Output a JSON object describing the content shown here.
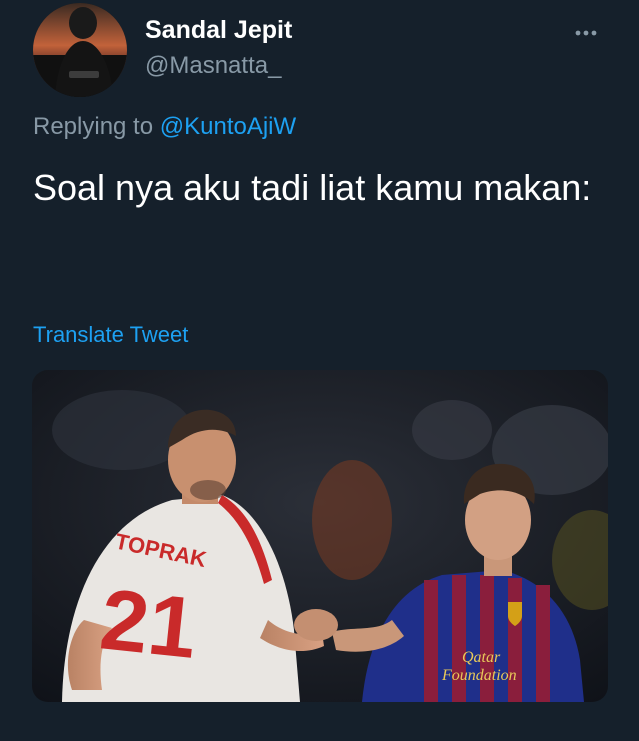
{
  "tweet": {
    "display_name": "Sandal Jepit",
    "handle": "@Masnatta_",
    "reply_prefix": "Replying to",
    "reply_to": "@KuntoAjiW",
    "text": "Soal nya aku tadi liat kamu makan:",
    "translate_label": "Translate Tweet"
  },
  "media": {
    "left_jersey_name": "TOPRAK",
    "left_jersey_number": "21",
    "right_jersey_sponsor_line1": "Qatar",
    "right_jersey_sponsor_line2": "Foundation"
  },
  "icons": {
    "more": "more-dots-icon"
  },
  "colors": {
    "background": "#15202b",
    "primary_text": "#ffffff",
    "secondary_text": "#8899a6",
    "accent": "#1da1f2"
  }
}
